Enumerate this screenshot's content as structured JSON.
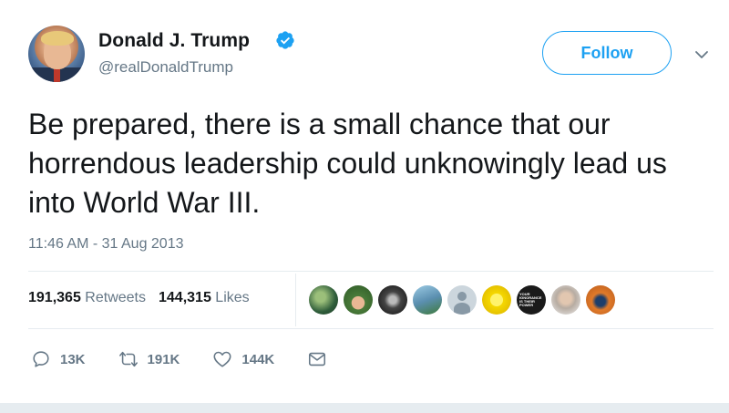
{
  "header": {
    "name": "Donald J. Trump",
    "handle": "@realDonaldTrump",
    "verified_icon": "verified-badge-icon",
    "follow_label": "Follow",
    "accent_color": "#1da1f2"
  },
  "tweet": {
    "text": "Be prepared, there is a small chance that our horrendous leadership could unknowingly lead us into World War III.",
    "timestamp": "11:46 AM - 31 Aug 2013"
  },
  "stats": {
    "retweets_count": "191,365",
    "retweets_label": "Retweets",
    "likes_count": "144,315",
    "likes_label": "Likes"
  },
  "liker_avatars": [
    {
      "icon": "liker-avatar-1",
      "color": "#3b6e4a"
    },
    {
      "icon": "liker-avatar-2",
      "color": "#4a7b3a"
    },
    {
      "icon": "liker-avatar-3",
      "color": "#222222"
    },
    {
      "icon": "liker-avatar-4",
      "color": "#5b8fb0"
    },
    {
      "icon": "liker-avatar-5",
      "color": "#ccd6dd"
    },
    {
      "icon": "liker-avatar-6",
      "color": "#f5d800"
    },
    {
      "icon": "liker-avatar-7",
      "color": "#1a1a1a",
      "text": "YOUR IGNORANCE IS THEIR POWER"
    },
    {
      "icon": "liker-avatar-8",
      "color": "#d8d2cc"
    },
    {
      "icon": "liker-avatar-9",
      "color": "#e07a2a"
    }
  ],
  "actions": {
    "reply_count": "13K",
    "retweet_count": "191K",
    "like_count": "144K"
  }
}
